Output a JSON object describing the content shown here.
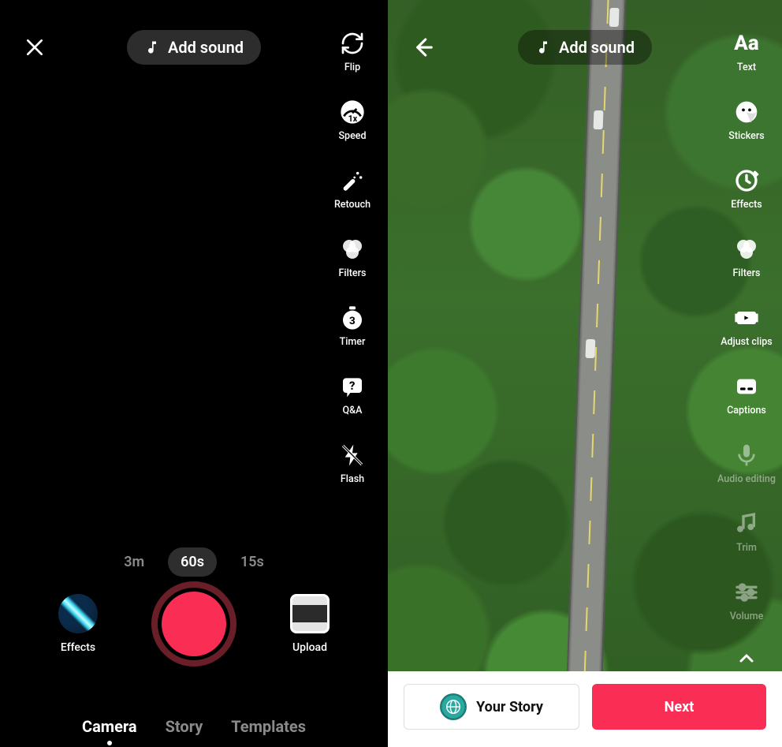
{
  "left": {
    "add_sound_label": "Add sound",
    "side_rail": [
      {
        "key": "flip",
        "label": "Flip"
      },
      {
        "key": "speed",
        "label": "Speed"
      },
      {
        "key": "retouch",
        "label": "Retouch"
      },
      {
        "key": "filters",
        "label": "Filters"
      },
      {
        "key": "timer",
        "label": "Timer"
      },
      {
        "key": "qa",
        "label": "Q&A"
      },
      {
        "key": "flash",
        "label": "Flash"
      }
    ],
    "durations": [
      {
        "label": "3m",
        "active": false
      },
      {
        "label": "60s",
        "active": true
      },
      {
        "label": "15s",
        "active": false
      }
    ],
    "effects_label": "Effects",
    "upload_label": "Upload",
    "mode_tabs": [
      {
        "label": "Camera",
        "active": true
      },
      {
        "label": "Story",
        "active": false
      },
      {
        "label": "Templates",
        "active": false
      }
    ]
  },
  "right": {
    "add_sound_label": "Add sound",
    "side_rail": [
      {
        "key": "text",
        "label": "Text",
        "faded": false
      },
      {
        "key": "stickers",
        "label": "Stickers",
        "faded": false
      },
      {
        "key": "effects",
        "label": "Effects",
        "faded": false
      },
      {
        "key": "filters",
        "label": "Filters",
        "faded": false
      },
      {
        "key": "adjust",
        "label": "Adjust clips",
        "faded": false
      },
      {
        "key": "captions",
        "label": "Captions",
        "faded": false
      },
      {
        "key": "audioedit",
        "label": "Audio editing",
        "faded": true
      },
      {
        "key": "trim",
        "label": "Trim",
        "faded": true
      },
      {
        "key": "volume",
        "label": "Volume",
        "faded": true
      }
    ],
    "your_story_label": "Your Story",
    "next_label": "Next"
  },
  "colors": {
    "accent": "#fa2d55"
  }
}
